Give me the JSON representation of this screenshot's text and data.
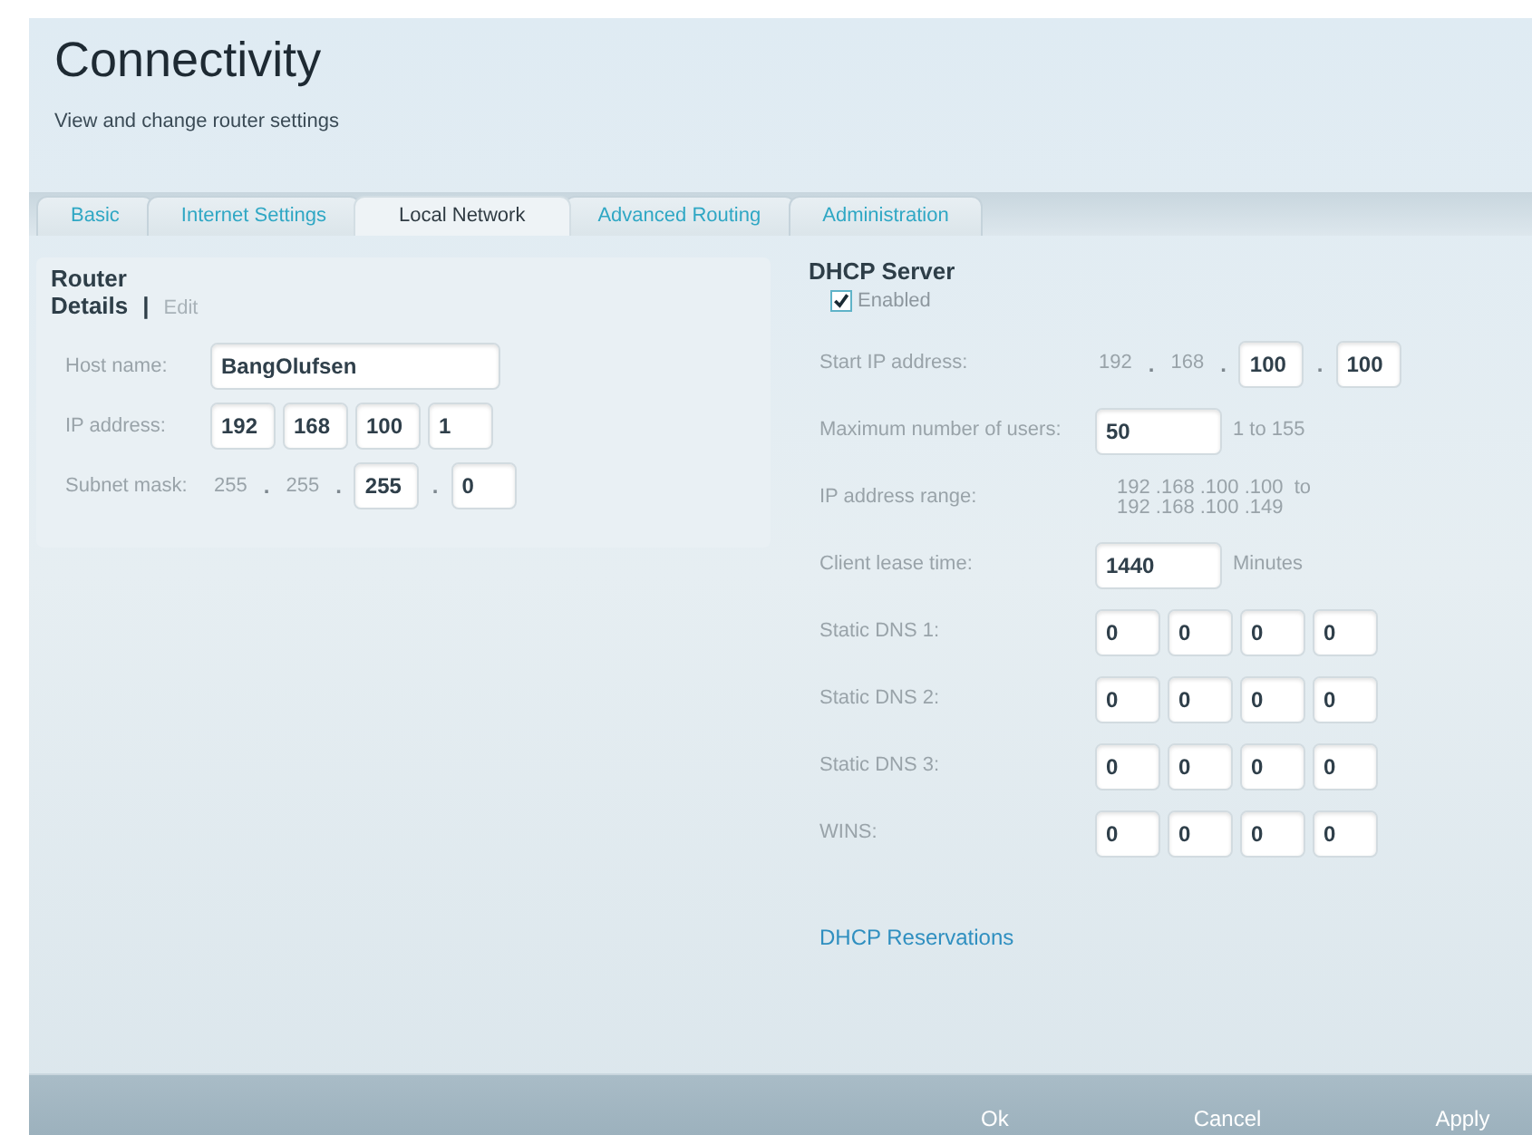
{
  "title": "Connectivity",
  "subtitle": "View and change router settings",
  "tabs": [
    {
      "label": "Basic",
      "selected": false
    },
    {
      "label": "Internet Settings",
      "selected": false
    },
    {
      "label": "Local Network",
      "selected": true
    },
    {
      "label": "Advanced Routing",
      "selected": false
    },
    {
      "label": "Administration",
      "selected": false
    }
  ],
  "router": {
    "title": "Router",
    "subtitle": "Details",
    "separator": "|",
    "edit": "Edit",
    "rows": [
      {
        "label": "Host name:",
        "parts": [
          {
            "kind": "input_wide",
            "value": "BangOlufsen"
          }
        ]
      },
      {
        "label": "IP address:",
        "parts": [
          {
            "kind": "input",
            "value": "192"
          },
          {
            "kind": "input",
            "value": "168"
          },
          {
            "kind": "input",
            "value": "100"
          },
          {
            "kind": "input",
            "value": "1"
          }
        ]
      },
      {
        "label": "Subnet mask:",
        "parts": [
          {
            "kind": "static",
            "text": "255"
          },
          {
            "kind": "dot",
            "text": "."
          },
          {
            "kind": "static",
            "text": "255"
          },
          {
            "kind": "dot",
            "text": "."
          },
          {
            "kind": "input",
            "value": "255"
          },
          {
            "kind": "dot",
            "text": "."
          },
          {
            "kind": "input",
            "value": "0"
          }
        ]
      }
    ]
  },
  "dhcp": {
    "title": "DHCP Server",
    "enabled": {
      "label": "Enabled",
      "checked": true
    },
    "rows": [
      {
        "label": "Start IP address:",
        "parts": [
          {
            "kind": "static",
            "text": "192"
          },
          {
            "kind": "dot",
            "text": "."
          },
          {
            "kind": "static",
            "text": "168"
          },
          {
            "kind": "dot",
            "text": "."
          },
          {
            "kind": "input",
            "value": "100"
          },
          {
            "kind": "dot",
            "text": "."
          },
          {
            "kind": "input",
            "value": "100"
          }
        ]
      },
      {
        "label": "Maximum number of users:",
        "parts": [
          {
            "kind": "input_medium",
            "value": "50"
          },
          {
            "kind": "static",
            "text": "1 to 155"
          }
        ]
      },
      {
        "label": "IP address range:",
        "parts": [
          {
            "kind": "lines",
            "lines": [
              "192 .168 .100 .100  to",
              "192 .168 .100 .149"
            ]
          }
        ]
      },
      {
        "label": "Client lease time:",
        "parts": [
          {
            "kind": "input_medium",
            "value": "1440"
          },
          {
            "kind": "static",
            "text": "Minutes"
          }
        ]
      },
      {
        "label": "Static DNS 1:",
        "parts": [
          {
            "kind": "input",
            "value": "0"
          },
          {
            "kind": "input",
            "value": "0"
          },
          {
            "kind": "input",
            "value": "0"
          },
          {
            "kind": "input",
            "value": "0"
          }
        ]
      },
      {
        "label": "Static DNS 2:",
        "parts": [
          {
            "kind": "input",
            "value": "0"
          },
          {
            "kind": "input",
            "value": "0"
          },
          {
            "kind": "input",
            "value": "0"
          },
          {
            "kind": "input",
            "value": "0"
          }
        ]
      },
      {
        "label": "Static DNS 3:",
        "parts": [
          {
            "kind": "input",
            "value": "0"
          },
          {
            "kind": "input",
            "value": "0"
          },
          {
            "kind": "input",
            "value": "0"
          },
          {
            "kind": "input",
            "value": "0"
          }
        ]
      },
      {
        "label": "WINS:",
        "parts": [
          {
            "kind": "input",
            "value": "0"
          },
          {
            "kind": "input",
            "value": "0"
          },
          {
            "kind": "input",
            "value": "0"
          },
          {
            "kind": "input",
            "value": "0"
          }
        ]
      }
    ],
    "link": "DHCP Reservations"
  },
  "buttons": [
    "Ok",
    "Cancel",
    "Apply"
  ]
}
